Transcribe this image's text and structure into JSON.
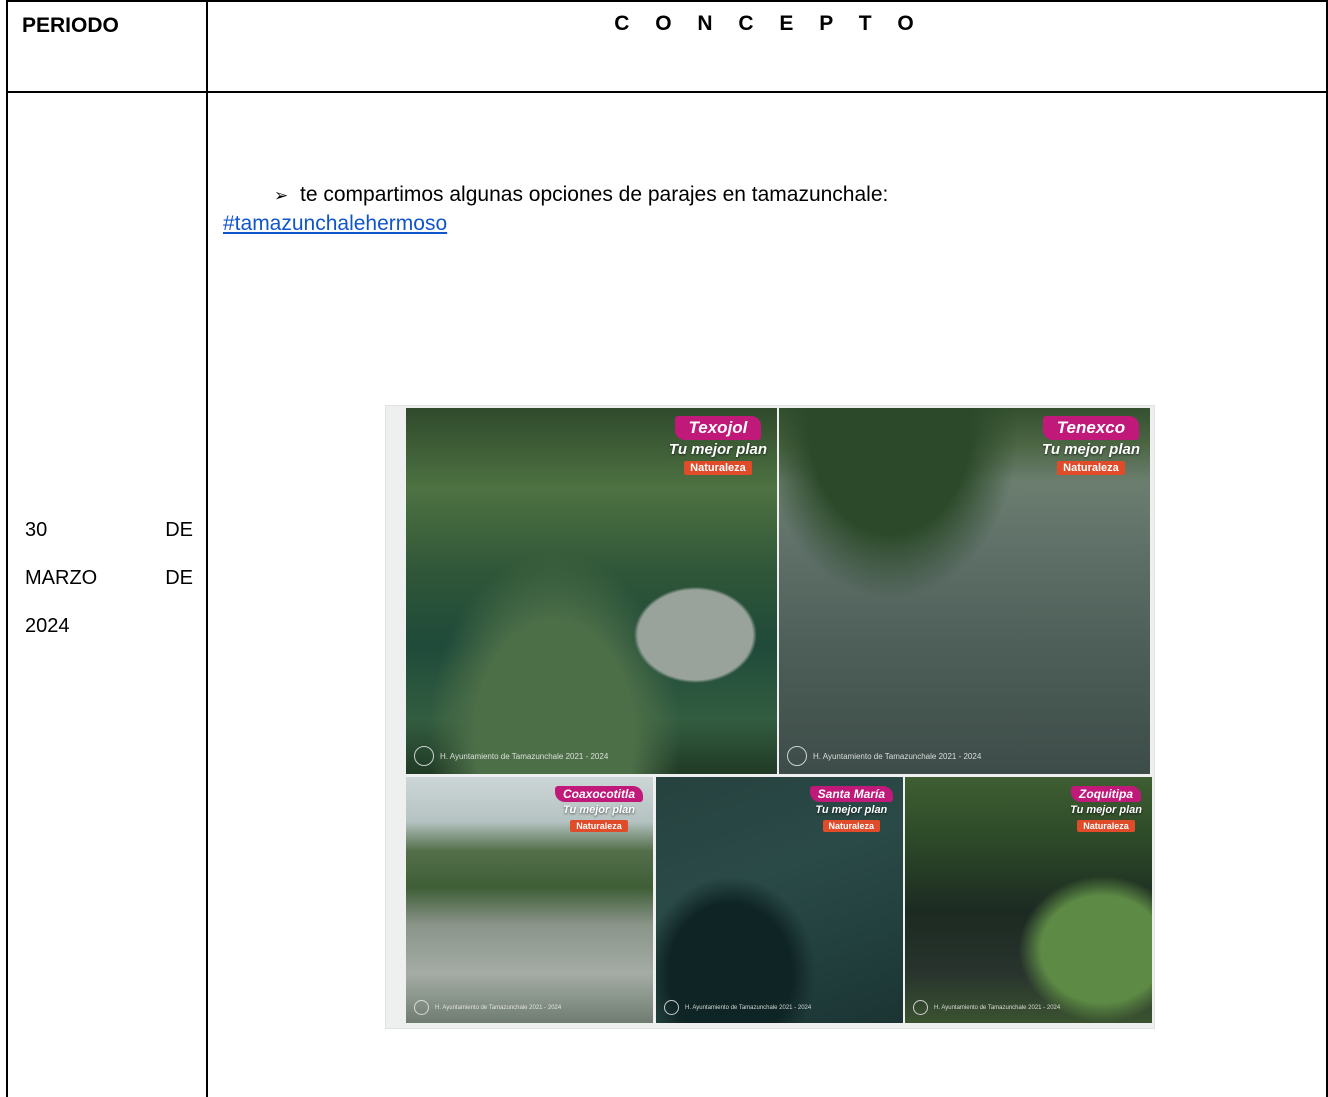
{
  "table": {
    "header": {
      "periodo": "PERIODO",
      "concepto": "C O N C E P T O"
    },
    "date_rows": [
      {
        "left": "30",
        "right": "DE"
      },
      {
        "left": "MARZO",
        "right": "DE"
      },
      {
        "left": "2024",
        "right": ""
      }
    ],
    "content": {
      "bullet_text": "te compartimos algunas opciones de parajes en tamazunchale:",
      "hashtag": "#tamazunchalehermoso"
    }
  },
  "collage": {
    "photos": [
      {
        "name": "Texojol",
        "plan": "Tu mejor plan",
        "badge": "Naturaleza",
        "footer": "H. Ayuntamiento de Tamazunchale 2021 - 2024"
      },
      {
        "name": "Tenexco",
        "plan": "Tu mejor plan",
        "badge": "Naturaleza",
        "footer": "H. Ayuntamiento de Tamazunchale 2021 - 2024"
      },
      {
        "name": "Coaxocotitla",
        "plan": "Tu mejor plan",
        "badge": "Naturaleza",
        "footer": "H. Ayuntamiento de Tamazunchale 2021 - 2024"
      },
      {
        "name": "Santa María",
        "plan": "Tu mejor plan",
        "badge": "Naturaleza",
        "footer": "H. Ayuntamiento de Tamazunchale 2021 - 2024"
      },
      {
        "name": "Zoquitipa",
        "plan": "Tu mejor plan",
        "badge": "Naturaleza",
        "footer": "H. Ayuntamiento de Tamazunchale 2021 - 2024"
      }
    ]
  }
}
